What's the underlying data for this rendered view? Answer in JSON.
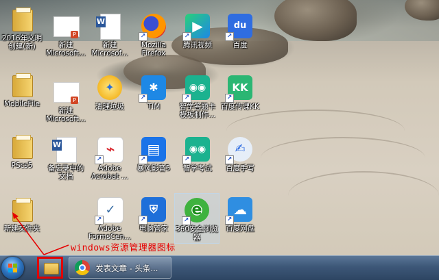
{
  "desktop": {
    "icons": [
      {
        "label": "2016年文明\n创建(新)",
        "type": "folder"
      },
      {
        "label": "新建\nMicrosoft...",
        "type": "ppt"
      },
      {
        "label": "新建\nMicrosof...",
        "type": "word"
      },
      {
        "label": "Mozilla\nFirefox",
        "type": "firefox"
      },
      {
        "label": "腾讯视频",
        "type": "tencent-video"
      },
      {
        "label": "百度",
        "type": "baidu"
      },
      {
        "label": "MobileFile",
        "type": "folder"
      },
      {
        "label": "新建\nMicrosoft...",
        "type": "ppt"
      },
      {
        "label": "清理垃圾",
        "type": "cleaner"
      },
      {
        "label": "TIM",
        "type": "tim"
      },
      {
        "label": "智学答题卡\n模板制作...",
        "type": "zhixue"
      },
      {
        "label": "百度传课KK",
        "type": "kk"
      },
      {
        "label": "PScs5",
        "type": "folder"
      },
      {
        "label": "备忘录中的\n文档",
        "type": "word"
      },
      {
        "label": "Adobe\nAcrobat ...",
        "type": "acrobat"
      },
      {
        "label": "暴风影音5",
        "type": "baofeng"
      },
      {
        "label": "智学考试",
        "type": "zhixue"
      },
      {
        "label": "百度手写",
        "type": "baidu-handwrite"
      },
      {
        "label": "新建文件夹",
        "type": "folder"
      },
      {
        "label": "Adobe\nFormsCen...",
        "type": "formscentral"
      },
      {
        "label": "电脑管家",
        "type": "pcmgr"
      },
      {
        "label": "360安全浏览\n器",
        "type": "360"
      },
      {
        "label": "百度网盘",
        "type": "baidupan"
      }
    ]
  },
  "annotation": {
    "text": "windows资源管理器图标",
    "color": "#e60000"
  },
  "taskbar": {
    "start_button": "start-orb",
    "pinned": [
      {
        "name": "windows-explorer",
        "highlighted": true
      }
    ],
    "open_windows": [
      {
        "app": "chrome",
        "title": "发表文章 - 头条..."
      }
    ]
  },
  "colors": {
    "taskbar": "#3d5778",
    "highlight_border": "#e00000",
    "label_text": "#ffffff"
  }
}
